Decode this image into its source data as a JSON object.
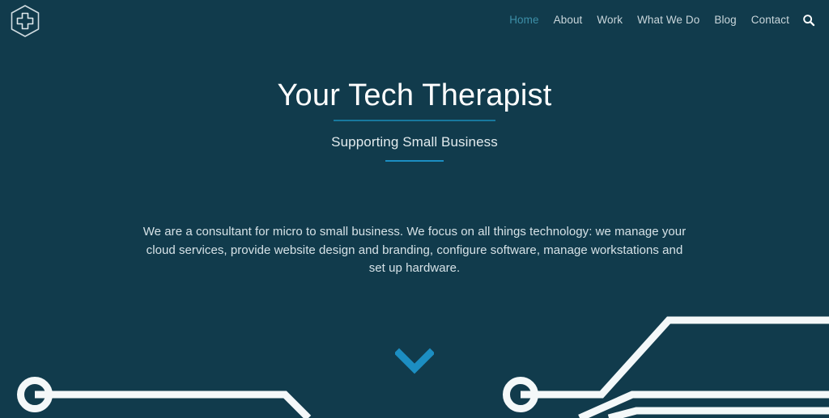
{
  "theme": {
    "background": "#113b4c",
    "accent_blue": "#1c8ec2",
    "rule_blue": "#17799e",
    "nav_active": "#3d8fa8",
    "nav_text": "#c9d6db",
    "trace_white": "#f4f8f9"
  },
  "header": {
    "logo_name": "hexagon-cross-logo",
    "nav": [
      {
        "label": "Home",
        "active": true
      },
      {
        "label": "About",
        "active": false
      },
      {
        "label": "Work",
        "active": false
      },
      {
        "label": "What We Do",
        "active": false
      },
      {
        "label": "Blog",
        "active": false
      },
      {
        "label": "Contact",
        "active": false
      }
    ],
    "search_icon": "search-icon"
  },
  "hero": {
    "title": "Your Tech Therapist",
    "subtitle": "Supporting Small Business",
    "body": "We are a consultant for micro to small business. We focus on all things technology: we manage your cloud services, provide website design and branding, configure software, manage workstations and set up hardware."
  },
  "scroll": {
    "icon": "chevron-down-icon"
  },
  "decoration": {
    "name": "circuit-trace-graphics",
    "node_count": 2
  }
}
